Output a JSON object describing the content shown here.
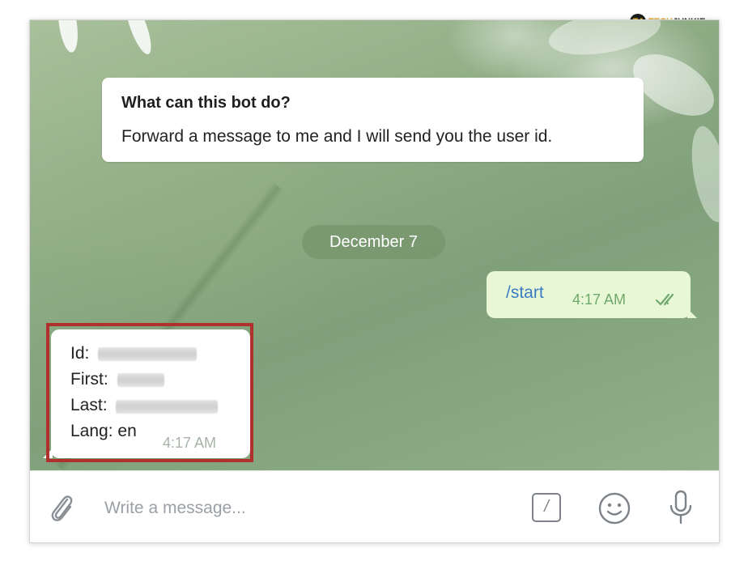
{
  "watermark": {
    "badge": "TJ",
    "brand_part1": "TECH",
    "brand_part2": "JUNKIE"
  },
  "bot_info": {
    "title": "What can this bot do?",
    "description": "Forward a message to me and I will send you the user id."
  },
  "date_separator": "December 7",
  "outgoing_message": {
    "text": "/start",
    "time": "4:17 AM",
    "status_icon": "double-check-icon"
  },
  "incoming_message": {
    "id_label": "Id:",
    "first_label": "First:",
    "last_label": "Last:",
    "lang_line": "Lang: en",
    "time": "4:17 AM"
  },
  "composer": {
    "placeholder": "Write a message...",
    "attach_icon": "paperclip-icon",
    "commands_icon": "slash-command-icon",
    "commands_glyph": "/",
    "emoji_icon": "smiley-icon",
    "mic_icon": "microphone-icon"
  },
  "colors": {
    "highlight_border": "#b0302e",
    "outgoing_bubble": "#e8f7d6",
    "link_text": "#3b7dc4"
  }
}
